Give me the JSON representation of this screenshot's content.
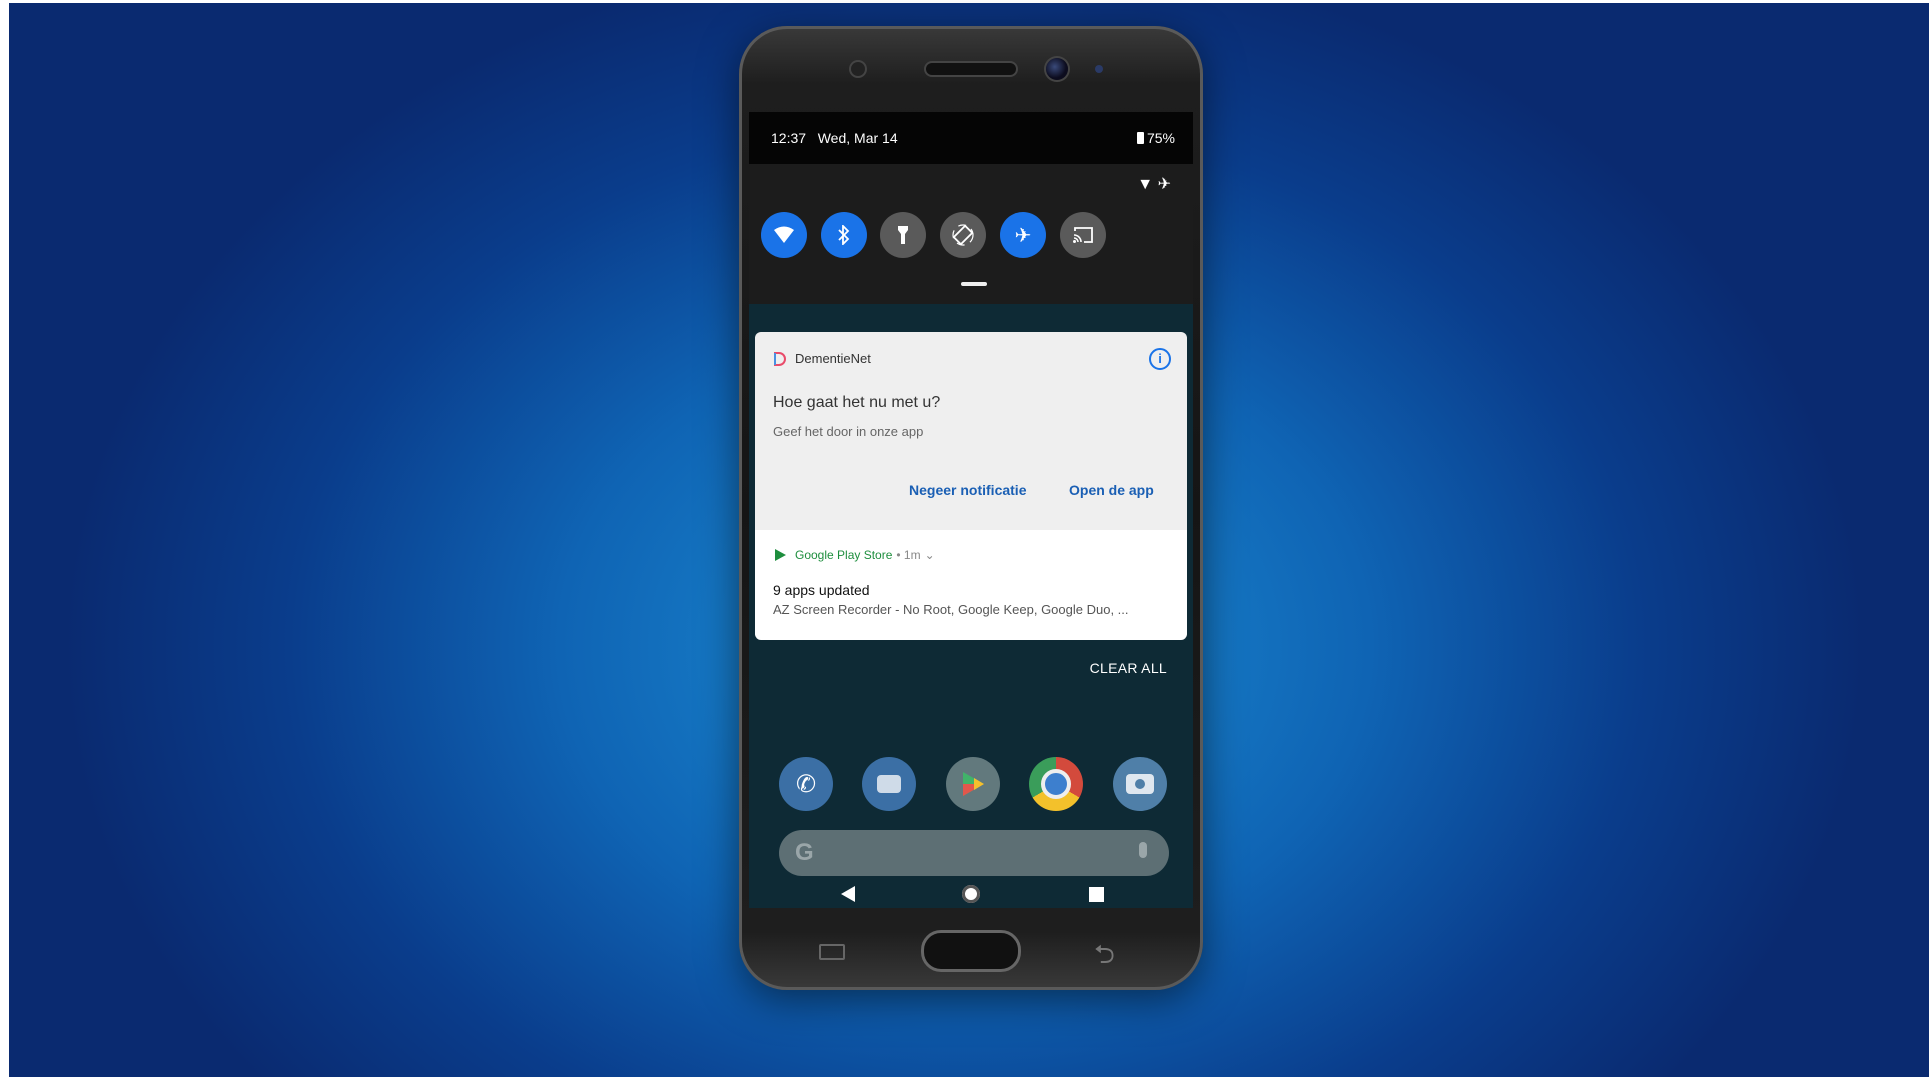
{
  "status_bar": {
    "time": "12:37",
    "date": "Wed, Mar 14",
    "battery": "75%"
  },
  "quick_settings": {
    "tiles": [
      {
        "name": "wifi",
        "active": true
      },
      {
        "name": "bluetooth",
        "active": true
      },
      {
        "name": "flashlight",
        "active": false
      },
      {
        "name": "auto-rotate",
        "active": false
      },
      {
        "name": "airplane-mode",
        "active": true
      },
      {
        "name": "cast",
        "active": false
      }
    ]
  },
  "notification1": {
    "app_name": "DementieNet",
    "title": "Hoe gaat het nu met u?",
    "body": "Geef het door in onze app",
    "action_dismiss": "Negeer notificatie",
    "action_open": "Open de app"
  },
  "notification2": {
    "app_name": "Google Play Store",
    "meta": "• 1m",
    "title": "9 apps updated",
    "body": "AZ Screen Recorder - No Root, Google Keep, Google Duo, ..."
  },
  "clear_all": "CLEAR ALL",
  "colors": {
    "accent": "#1a73e8",
    "play_green": "#1e8e3e",
    "background": "#0f64b4"
  }
}
